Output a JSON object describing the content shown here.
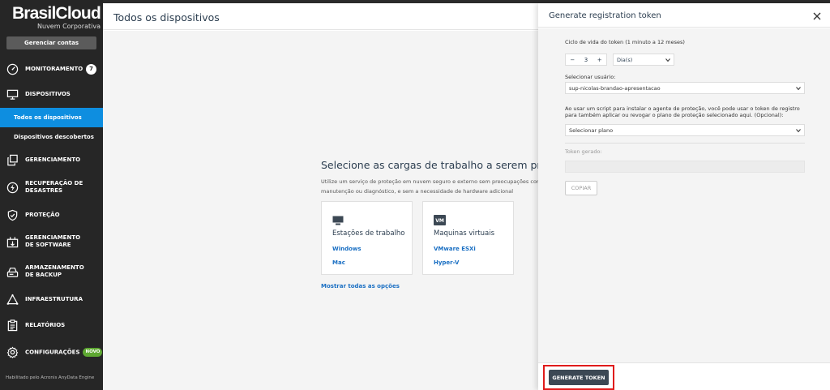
{
  "brand": {
    "name": "BrasilCloud",
    "subtitle": "Nuvem Corporativa"
  },
  "sidebar": {
    "manage_label": "Gerenciar contas",
    "items": [
      {
        "label": "MONITORAMENTO",
        "icon": "gauge-icon",
        "badge": "7"
      },
      {
        "label": "DISPOSITIVOS",
        "icon": "monitor-icon"
      },
      {
        "label": "GERENCIAMENTO",
        "icon": "copy-icon"
      },
      {
        "label": "RECUPERAÇÃO DE DESASTRES",
        "icon": "lightning-icon"
      },
      {
        "label": "PROTEÇÃO",
        "icon": "shield-icon"
      },
      {
        "label": "GERENCIAMENTO DE SOFTWARE",
        "icon": "software-icon"
      },
      {
        "label": "ARMAZENAMENTO DE BACKUP",
        "icon": "storage-icon"
      },
      {
        "label": "INFRAESTRUTURA",
        "icon": "triangle-network-icon"
      },
      {
        "label": "RELATÓRIOS",
        "icon": "clipboard-icon"
      },
      {
        "label": "CONFIGURAÇÕES",
        "icon": "gear-icon",
        "new_badge": "NOVO"
      }
    ],
    "sub_items": [
      {
        "label": "Todos os dispositivos",
        "active": true
      },
      {
        "label": "Dispositivos descobertos",
        "active": false
      }
    ],
    "powered_by": "Habilitado pelo Acronis AnyData Engine"
  },
  "main": {
    "title": "Todos os dispositivos",
    "empty_title": "Selecione as cargas de trabalho a serem protegi",
    "empty_desc_line1": "Utilize um serviço de proteção em nuvem seguro e externo sem preocupações com",
    "empty_desc_line2": "manutenção ou diagnóstico, e sem a necessidade de hardware adicional",
    "cards": [
      {
        "title": "Estações de trabalho",
        "icon": "desktop-icon",
        "links": [
          "Windows",
          "Mac"
        ]
      },
      {
        "title": "Maquinas virtuais",
        "icon": "vm-icon",
        "icon_text": "VM",
        "links": [
          "VMware ESXi",
          "Hyper-V"
        ]
      }
    ],
    "show_all": "Mostrar todas as opções"
  },
  "panel": {
    "title": "Generate registration token",
    "lifetime_label": "Ciclo de vida do token (1 minuto a 12 meses)",
    "stepper": {
      "minus": "−",
      "value": "3",
      "plus": "+"
    },
    "unit": "Dia(s)",
    "user_label": "Selecionar usuário:",
    "user_value": "sup-nicolas-brandao-apresentacao",
    "plan_label_line1": "Ao usar um script para instalar o agente de proteção, você pode usar o token de registro",
    "plan_label_line2": "para também aplicar ou revogar o plano de proteção selecionado aqui. (Opcional):",
    "plan_value": "Selecionar plano",
    "token_label": "Token gerado:",
    "copy_label": "COPIAR",
    "generate_label": "GENERATE TOKEN"
  }
}
